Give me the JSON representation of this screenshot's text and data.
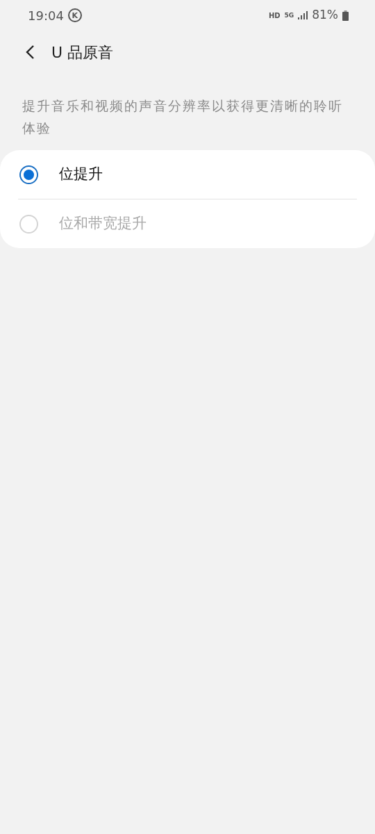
{
  "status_bar": {
    "time": "19:04",
    "badge": "K",
    "hd": "HD",
    "network": "5G",
    "battery": "81%"
  },
  "header": {
    "title": "U 品原音"
  },
  "description": "提升音乐和视频的声音分辨率以获得更清晰的聆听体验",
  "options": [
    {
      "label": "位提升",
      "selected": true,
      "disabled": false
    },
    {
      "label": "位和带宽提升",
      "selected": false,
      "disabled": true
    }
  ]
}
